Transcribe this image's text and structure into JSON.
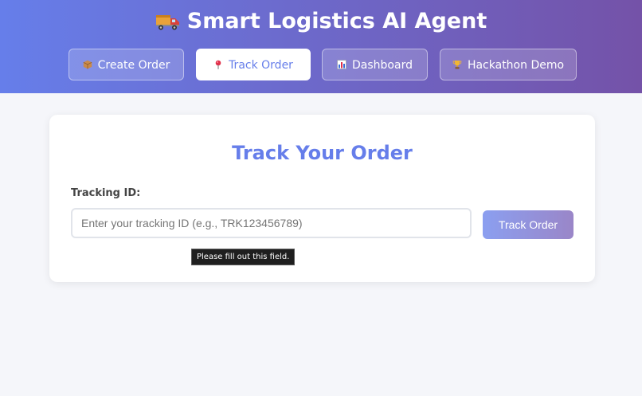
{
  "header": {
    "title": "Smart Logistics AI Agent",
    "icon": "truck-icon"
  },
  "nav": {
    "tabs": [
      {
        "label": "Create Order",
        "icon": "package-icon",
        "active": false
      },
      {
        "label": "Track Order",
        "icon": "pin-icon",
        "active": true
      },
      {
        "label": "Dashboard",
        "icon": "bar-chart-icon",
        "active": false
      },
      {
        "label": "Hackathon Demo",
        "icon": "trophy-icon",
        "active": false
      }
    ]
  },
  "track": {
    "title": "Track Your Order",
    "field_label": "Tracking ID:",
    "input_value": "",
    "input_placeholder": "Enter your tracking ID (e.g., TRK123456789)",
    "button_label": "Track Order",
    "validation_tooltip": "Please fill out this field."
  },
  "colors": {
    "accent": "#667eea",
    "header_gradient_end": "#7452a8",
    "page_background": "#f5f6fa"
  }
}
